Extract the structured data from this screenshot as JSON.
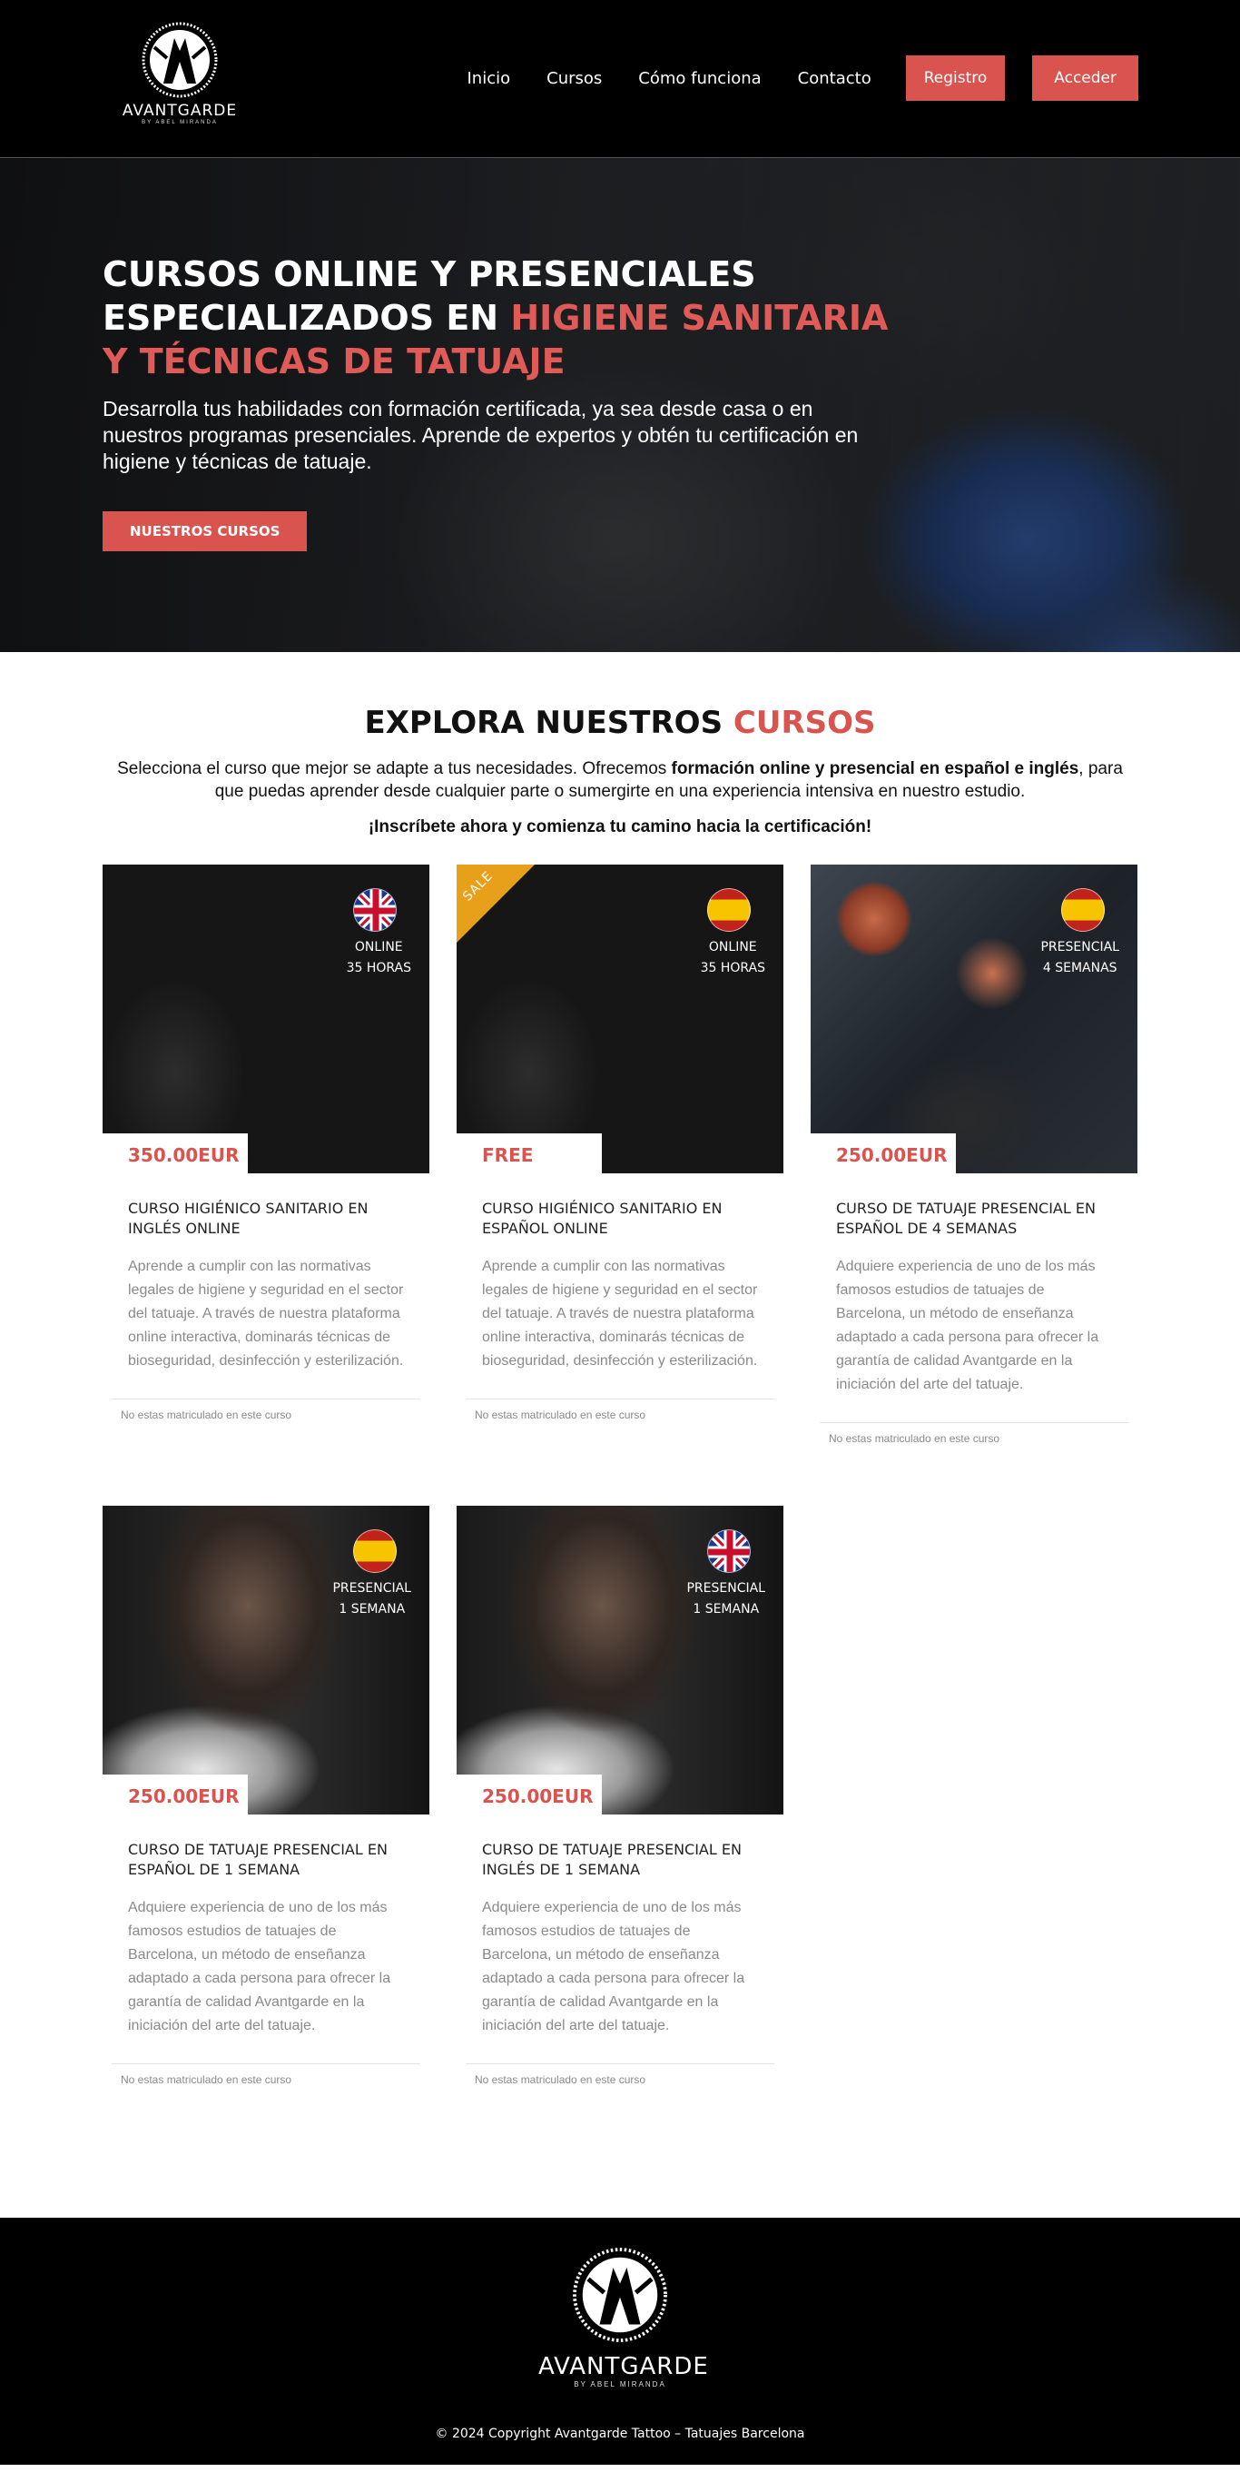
{
  "header": {
    "logo_text": "AVANTGARDE",
    "logo_sub": "BY ABEL MIRANDA",
    "nav": [
      "Inicio",
      "Cursos",
      "Cómo funciona",
      "Contacto"
    ],
    "register_label": "Registro",
    "login_label": "Acceder",
    "accent": "#d9534f"
  },
  "hero": {
    "title_line1": "CURSOS ONLINE Y PRESENCIALES",
    "title_line2_pre": "ESPECIALIZADOS EN ",
    "title_line2_hl": "HIGIENE SANITARIA",
    "title_line3_hl": "Y TÉCNICAS DE TATUAJE",
    "description": "Desarrolla tus habilidades con formación certificada, ya sea desde casa o en nuestros programas presenciales. Aprende de expertos y obtén tu certificación en higiene y técnicas de tatuaje.",
    "button_label": "NUESTROS CURSOS"
  },
  "courses": {
    "heading_pre": "EXPLORA NUESTROS ",
    "heading_hl": "CURSOS",
    "intro_pre": "Selecciona el curso que mejor se adapte a tus necesidades. Ofrecemos ",
    "intro_bold": "formación online y presencial en español e inglés",
    "intro_post": ", para que puedas aprender desde cualquier parte o sumergirte en una experiencia intensiva en nuestro estudio.",
    "cta": "¡Inscríbete ahora y comienza tu camino hacia la certificación!",
    "items": [
      {
        "flag": "uk-flag-icon",
        "mode": "ONLINE",
        "duration": "35 HORAS",
        "price": "350.00EUR",
        "title": "CURSO HIGIÉNICO SANITARIO EN INGLÉS ONLINE",
        "description": "Aprende a cumplir con las normativas legales de higiene y seguridad en el sector del tatuaje. A través de nuestra plataforma online interactiva, dominarás técnicas de bioseguridad, desinfección y esterilización.",
        "status": "No estas matriculado en este curso"
      },
      {
        "flag": "spain-flag-icon",
        "sale": "SALE",
        "mode": "ONLINE",
        "duration": "35 HORAS",
        "price": "FREE",
        "title": "CURSO HIGIÉNICO SANITARIO EN ESPAÑOL ONLINE",
        "description": "Aprende a cumplir con las normativas legales de higiene y seguridad en el sector del tatuaje. A través de nuestra plataforma online interactiva, dominarás técnicas de bioseguridad, desinfección y esterilización.",
        "status": "No estas matriculado en este curso"
      },
      {
        "flag": "spain-flag-icon",
        "mode": "PRESENCIAL",
        "duration": "4 SEMANAS",
        "price": "250.00EUR",
        "title": "CURSO DE TATUAJE PRESENCIAL EN ESPAÑOL DE 4 SEMANAS",
        "description": "Adquiere experiencia de uno de los más famosos estudios de tatuajes de Barcelona, un método de enseñanza adaptado a cada persona para ofrecer la garantía de calidad Avantgarde en la iniciación del arte del tatuaje.",
        "status": "No estas matriculado en este curso"
      },
      {
        "flag": "spain-flag-icon",
        "mode": "PRESENCIAL",
        "duration": "1 SEMANA",
        "price": "250.00EUR",
        "title": "CURSO DE TATUAJE PRESENCIAL EN ESPAÑOL DE 1 SEMANA",
        "description": "Adquiere experiencia de uno de los más famosos estudios de tatuajes de Barcelona, un método de enseñanza adaptado a cada persona para ofrecer la garantía de calidad Avantgarde en la iniciación del arte del tatuaje.",
        "status": "No estas matriculado en este curso"
      },
      {
        "flag": "uk-flag-icon",
        "mode": "PRESENCIAL",
        "duration": "1 SEMANA",
        "price": "250.00EUR",
        "title": "CURSO DE TATUAJE PRESENCIAL EN INGLÉS DE 1 SEMANA",
        "description": "Adquiere experiencia de uno de los más famosos estudios de tatuajes de Barcelona, un método de enseñanza adaptado a cada persona para ofrecer la garantía de calidad Avantgarde en la iniciación del arte del tatuaje.",
        "status": "No estas matriculado en este curso"
      }
    ]
  },
  "footer": {
    "logo_text": "AVANTGARDE",
    "logo_sub": "BY ABEL MIRANDA",
    "copyright": "© 2024 Copyright Avantgarde Tattoo – Tatuajes Barcelona"
  }
}
